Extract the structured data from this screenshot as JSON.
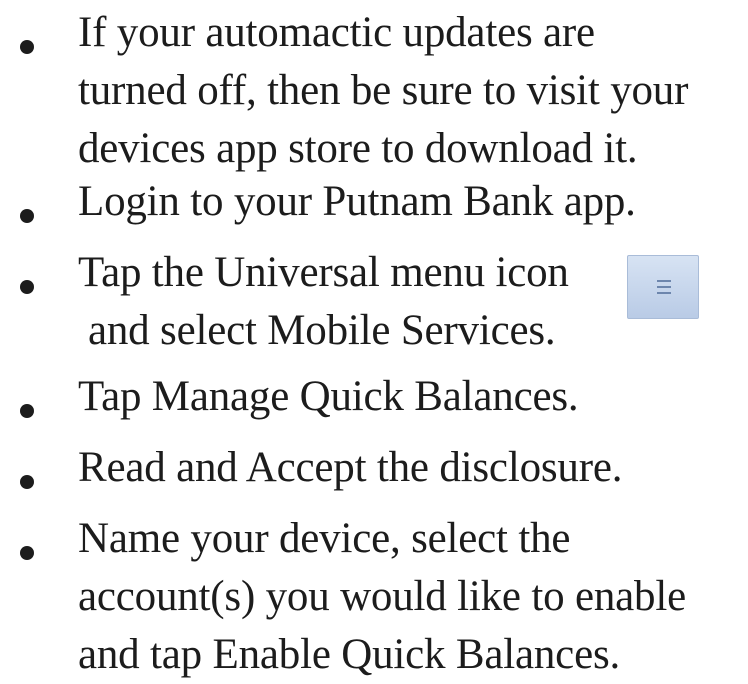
{
  "steps": [
    {
      "lines": [
        "If your automactic updates are",
        "turned off, then be sure to visit your",
        "devices app store to download it."
      ]
    },
    {
      "lines": [
        "Login to your Putnam Bank app."
      ]
    },
    {
      "lines": [
        "Tap the Universal menu icon",
        "and select Mobile Services."
      ],
      "icon": "hamburger-menu-icon"
    },
    {
      "lines": [
        "Tap Manage Quick Balances."
      ]
    },
    {
      "lines": [
        "Read and Accept the disclosure."
      ]
    },
    {
      "lines": [
        "Name your device, select the",
        "account(s) you would like to enable",
        "and tap Enable Quick Balances."
      ]
    }
  ]
}
